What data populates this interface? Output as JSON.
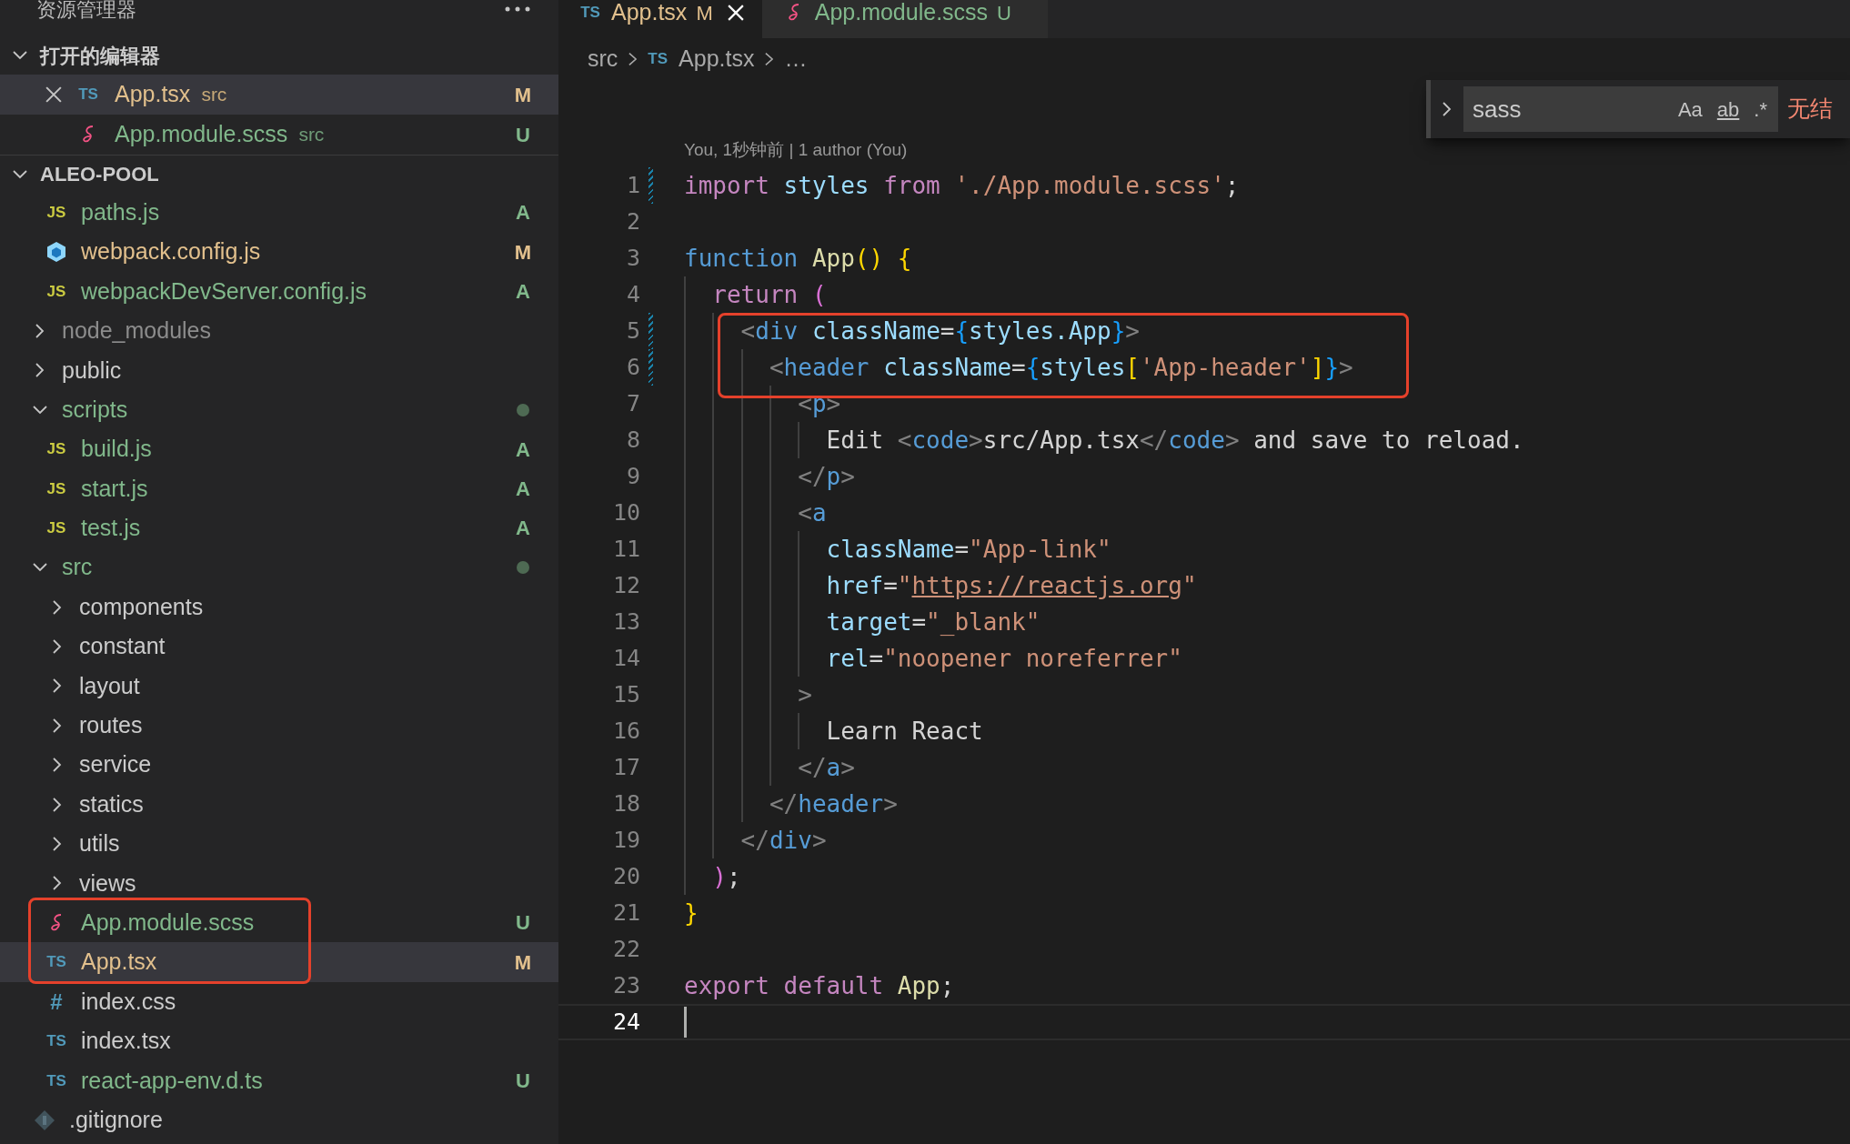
{
  "sidebar": {
    "title": "资源管理器",
    "open_editors": {
      "title": "打开的编辑器",
      "expanded": true,
      "items": [
        {
          "kind": "ts_file",
          "icon_text": "TS",
          "name": "App.tsx",
          "description": "src",
          "status": "M",
          "selected": true
        },
        {
          "kind": "sass_file",
          "name": "App.module.scss",
          "description": "src",
          "status": "U",
          "selected": false
        }
      ]
    },
    "workspace": {
      "title": "ALEO-POOL",
      "expanded": true,
      "tree": [
        {
          "kind": "continued",
          "children": [
            {
              "kind": "js_file",
              "icon_text": "JS",
              "name": "paths.js",
              "status": "A",
              "selected": false,
              "boxed": false
            },
            {
              "kind": "webpack_file",
              "name": "webpack.config.js",
              "status": "M",
              "selected": false,
              "boxed": false
            },
            {
              "kind": "js_file",
              "icon_text": "JS",
              "name": "webpackDevServer.config.js",
              "status": "A",
              "selected": false,
              "boxed": false
            }
          ]
        },
        {
          "kind": "folder",
          "name": "node_modules",
          "expanded": false,
          "ignored": true,
          "changed": false,
          "selected": false
        },
        {
          "kind": "folder",
          "name": "public",
          "expanded": false,
          "ignored": false,
          "changed": false,
          "selected": false
        },
        {
          "kind": "folder",
          "name": "scripts",
          "expanded": true,
          "ignored": false,
          "changed": true,
          "selected": false,
          "children": [
            {
              "kind": "js_file",
              "icon_text": "JS",
              "name": "build.js",
              "status": "A",
              "selected": false,
              "boxed": false
            },
            {
              "kind": "js_file",
              "icon_text": "JS",
              "name": "start.js",
              "status": "A",
              "selected": false,
              "boxed": false
            },
            {
              "kind": "js_file",
              "icon_text": "JS",
              "name": "test.js",
              "status": "A",
              "selected": false,
              "boxed": false
            }
          ]
        },
        {
          "kind": "folder",
          "name": "src",
          "expanded": true,
          "ignored": false,
          "changed": true,
          "selected": false,
          "children": [
            {
              "kind": "folder",
              "name": "components",
              "expanded": false,
              "ignored": false,
              "changed": false,
              "selected": false
            },
            {
              "kind": "folder",
              "name": "constant",
              "expanded": false,
              "ignored": false,
              "changed": false,
              "selected": false
            },
            {
              "kind": "folder",
              "name": "layout",
              "expanded": false,
              "ignored": false,
              "changed": false,
              "selected": false
            },
            {
              "kind": "folder",
              "name": "routes",
              "expanded": false,
              "ignored": false,
              "changed": false,
              "selected": false
            },
            {
              "kind": "folder",
              "name": "service",
              "expanded": false,
              "ignored": false,
              "changed": false,
              "selected": false
            },
            {
              "kind": "folder",
              "name": "statics",
              "expanded": false,
              "ignored": false,
              "changed": false,
              "selected": false
            },
            {
              "kind": "folder",
              "name": "utils",
              "expanded": false,
              "ignored": false,
              "changed": false,
              "selected": false
            },
            {
              "kind": "folder",
              "name": "views",
              "expanded": false,
              "ignored": false,
              "changed": false,
              "selected": false
            },
            {
              "kind": "sass_file",
              "name": "App.module.scss",
              "status": "U",
              "selected": false,
              "boxed": true
            },
            {
              "kind": "ts_file",
              "icon_text": "TS",
              "name": "App.tsx",
              "status": "M",
              "selected": true,
              "boxed": true
            },
            {
              "kind": "css_file",
              "icon_text": "#",
              "name": "index.css",
              "selected": false,
              "boxed": false
            },
            {
              "kind": "ts_file",
              "icon_text": "TS",
              "name": "index.tsx",
              "selected": false,
              "boxed": false
            },
            {
              "kind": "ts_file",
              "icon_text": "TS",
              "name": "react-app-env.d.ts",
              "status": "U",
              "selected": false,
              "boxed": false
            }
          ]
        },
        {
          "kind": "git_file",
          "name": ".gitignore",
          "selected": false,
          "boxed": false
        }
      ]
    }
  },
  "tabs": [
    {
      "kind": "ts_file",
      "icon_text": "TS",
      "label": "App.tsx",
      "status": "M",
      "selected": true
    },
    {
      "kind": "sass_file",
      "label": "App.module.scss",
      "status": "U",
      "selected": false
    }
  ],
  "breadcrumb": [
    {
      "kind": "text",
      "text": "src"
    },
    {
      "kind": "ts_file",
      "icon_text": "TS",
      "text": "App.tsx"
    },
    {
      "kind": "text",
      "text": "…"
    }
  ],
  "find_widget": {
    "replace_expanded": false,
    "value": "sass",
    "options": [
      {
        "text": "Aa",
        "on": false
      },
      {
        "text": "ab",
        "on": false
      },
      {
        "text": ".*",
        "on": false
      }
    ],
    "result": "无结"
  },
  "codelens": "You, 1秒钟前 | 1 author (You)",
  "code_lines": [
    {
      "number": "1",
      "modified": true,
      "boxed": false,
      "current": false,
      "tokens": [
        {
          "kind": "kw",
          "text": "import "
        },
        {
          "kind": "var",
          "text": "styles "
        },
        {
          "kind": "kw",
          "text": "from "
        },
        {
          "kind": "str",
          "text": "'./App.module.scss'"
        },
        {
          "kind": "p",
          "text": ";"
        }
      ]
    },
    {
      "number": "2",
      "modified": false,
      "boxed": false,
      "current": false
    },
    {
      "number": "3",
      "modified": false,
      "boxed": false,
      "current": false,
      "tokens": [
        {
          "kind": "st",
          "text": "function "
        },
        {
          "kind": "fn",
          "text": "App"
        },
        {
          "kind": "br1",
          "text": "() {"
        }
      ]
    },
    {
      "number": "4",
      "modified": false,
      "boxed": false,
      "current": false,
      "tokens": [
        {
          "kind": "kw",
          "text": "  return "
        },
        {
          "kind": "br2",
          "text": "("
        }
      ]
    },
    {
      "number": "5",
      "modified": true,
      "boxed": true,
      "current": false,
      "tokens": [
        {
          "kind": "ang",
          "text": "    <"
        },
        {
          "kind": "st",
          "text": "div"
        },
        {
          "kind": "var",
          "text": " className"
        },
        {
          "kind": "p",
          "text": "="
        },
        {
          "kind": "br3",
          "text": "{"
        },
        {
          "kind": "var",
          "text": "styles.App"
        },
        {
          "kind": "br3",
          "text": "}"
        },
        {
          "kind": "ang",
          "text": ">"
        }
      ]
    },
    {
      "number": "6",
      "modified": true,
      "boxed": true,
      "current": false,
      "tokens": [
        {
          "kind": "ang",
          "text": "      <"
        },
        {
          "kind": "st",
          "text": "header"
        },
        {
          "kind": "var",
          "text": " className"
        },
        {
          "kind": "p",
          "text": "="
        },
        {
          "kind": "br3",
          "text": "{"
        },
        {
          "kind": "var",
          "text": "styles"
        },
        {
          "kind": "br1",
          "text": "["
        },
        {
          "kind": "str",
          "text": "'App-header'"
        },
        {
          "kind": "br1",
          "text": "]"
        },
        {
          "kind": "br3",
          "text": "}"
        },
        {
          "kind": "ang",
          "text": ">"
        }
      ]
    },
    {
      "number": "7",
      "modified": false,
      "boxed": false,
      "current": false,
      "tokens": [
        {
          "kind": "ang",
          "text": "        <"
        },
        {
          "kind": "st",
          "text": "p"
        },
        {
          "kind": "ang",
          "text": ">"
        }
      ]
    },
    {
      "number": "8",
      "modified": false,
      "boxed": false,
      "current": false,
      "tokens": [
        {
          "kind": "txt",
          "text": "          Edit "
        },
        {
          "kind": "ang",
          "text": "<"
        },
        {
          "kind": "st",
          "text": "code"
        },
        {
          "kind": "ang",
          "text": ">"
        },
        {
          "kind": "txt",
          "text": "src/App.tsx"
        },
        {
          "kind": "ang",
          "text": "</"
        },
        {
          "kind": "st",
          "text": "code"
        },
        {
          "kind": "ang",
          "text": ">"
        },
        {
          "kind": "txt",
          "text": " and save to reload."
        }
      ]
    },
    {
      "number": "9",
      "modified": false,
      "boxed": false,
      "current": false,
      "tokens": [
        {
          "kind": "ang",
          "text": "        </"
        },
        {
          "kind": "st",
          "text": "p"
        },
        {
          "kind": "ang",
          "text": ">"
        }
      ]
    },
    {
      "number": "10",
      "modified": false,
      "boxed": false,
      "current": false,
      "tokens": [
        {
          "kind": "ang",
          "text": "        <"
        },
        {
          "kind": "st",
          "text": "a"
        }
      ]
    },
    {
      "number": "11",
      "modified": false,
      "boxed": false,
      "current": false,
      "tokens": [
        {
          "kind": "var",
          "text": "          className"
        },
        {
          "kind": "p",
          "text": "="
        },
        {
          "kind": "str",
          "text": "\"App-link\""
        }
      ]
    },
    {
      "number": "12",
      "modified": false,
      "boxed": false,
      "current": false,
      "tokens": [
        {
          "kind": "var",
          "text": "          href"
        },
        {
          "kind": "p",
          "text": "="
        },
        {
          "kind": "str",
          "text": "\""
        },
        {
          "kind": "url",
          "text": "https://reactjs.org"
        },
        {
          "kind": "str",
          "text": "\""
        }
      ]
    },
    {
      "number": "13",
      "modified": false,
      "boxed": false,
      "current": false,
      "tokens": [
        {
          "kind": "var",
          "text": "          target"
        },
        {
          "kind": "p",
          "text": "="
        },
        {
          "kind": "str",
          "text": "\"_blank\""
        }
      ]
    },
    {
      "number": "14",
      "modified": false,
      "boxed": false,
      "current": false,
      "tokens": [
        {
          "kind": "var",
          "text": "          rel"
        },
        {
          "kind": "p",
          "text": "="
        },
        {
          "kind": "str",
          "text": "\"noopener noreferrer\""
        }
      ]
    },
    {
      "number": "15",
      "modified": false,
      "boxed": false,
      "current": false,
      "tokens": [
        {
          "kind": "ang",
          "text": "        >"
        }
      ]
    },
    {
      "number": "16",
      "modified": false,
      "boxed": false,
      "current": false,
      "tokens": [
        {
          "kind": "txt",
          "text": "          Learn React"
        }
      ]
    },
    {
      "number": "17",
      "modified": false,
      "boxed": false,
      "current": false,
      "tokens": [
        {
          "kind": "ang",
          "text": "        </"
        },
        {
          "kind": "st",
          "text": "a"
        },
        {
          "kind": "ang",
          "text": ">"
        }
      ]
    },
    {
      "number": "18",
      "modified": false,
      "boxed": false,
      "current": false,
      "tokens": [
        {
          "kind": "ang",
          "text": "      </"
        },
        {
          "kind": "st",
          "text": "header"
        },
        {
          "kind": "ang",
          "text": ">"
        }
      ]
    },
    {
      "number": "19",
      "modified": false,
      "boxed": false,
      "current": false,
      "tokens": [
        {
          "kind": "ang",
          "text": "    </"
        },
        {
          "kind": "st",
          "text": "div"
        },
        {
          "kind": "ang",
          "text": ">"
        }
      ]
    },
    {
      "number": "20",
      "modified": false,
      "boxed": false,
      "current": false,
      "tokens": [
        {
          "kind": "br2",
          "text": "  )"
        },
        {
          "kind": "p",
          "text": ";"
        }
      ]
    },
    {
      "number": "21",
      "modified": false,
      "boxed": false,
      "current": false,
      "tokens": [
        {
          "kind": "br1",
          "text": "}"
        }
      ]
    },
    {
      "number": "22",
      "modified": false,
      "boxed": false,
      "current": false
    },
    {
      "number": "23",
      "modified": false,
      "boxed": false,
      "current": false,
      "tokens": [
        {
          "kind": "kw",
          "text": "export default "
        },
        {
          "kind": "fn",
          "text": "App"
        },
        {
          "kind": "p",
          "text": ";"
        }
      ]
    },
    {
      "number": "24",
      "modified": false,
      "boxed": false,
      "current": true
    }
  ]
}
